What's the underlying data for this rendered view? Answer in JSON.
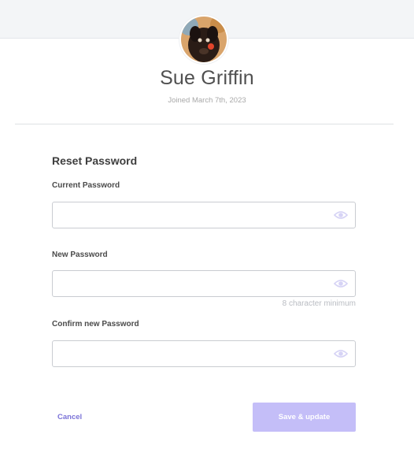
{
  "profile": {
    "name": "Sue Griffin",
    "joined": "Joined March 7th, 2023"
  },
  "reset": {
    "title": "Reset Password",
    "current_label": "Current Password",
    "current_value": "",
    "new_label": "New Password",
    "new_value": "",
    "new_hint": "8 character minimum",
    "confirm_label": "Confirm new Password",
    "confirm_value": ""
  },
  "actions": {
    "cancel_label": "Cancel",
    "save_label": "Save & update"
  },
  "colors": {
    "accent": "#7b73d8",
    "save_button_disabled": "#c4bef8",
    "eye_icon": "#d6d3f5",
    "top_band": "#f3f5f7"
  },
  "icons": {
    "field_icon": "eye-icon"
  }
}
